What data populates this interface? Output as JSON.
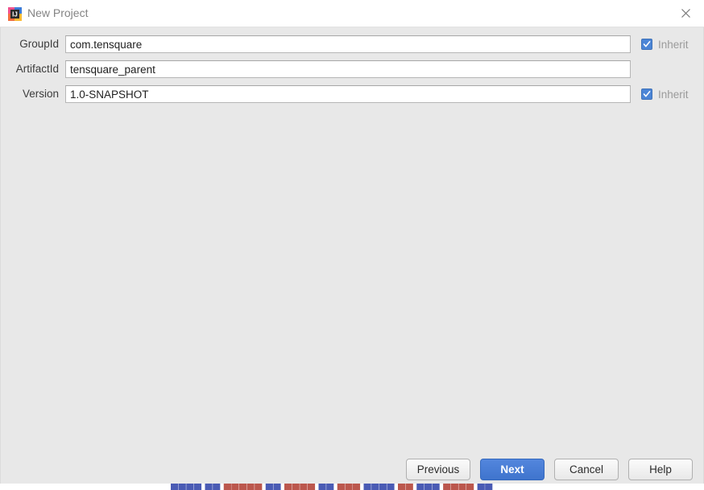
{
  "window": {
    "title": "New Project",
    "app_icon": "intellij-idea-icon",
    "close_icon": "close-icon"
  },
  "form": {
    "rows": [
      {
        "label": "GroupId",
        "value": "com.tensquare",
        "placeholder": "",
        "has_inherit": true,
        "inherit_label": "Inherit",
        "inherit_checked": true
      },
      {
        "label": "ArtifactId",
        "value": "tensquare_parent",
        "placeholder": "",
        "has_inherit": false,
        "inherit_label": "",
        "inherit_checked": false
      },
      {
        "label": "Version",
        "value": "1.0-SNAPSHOT",
        "placeholder": "",
        "has_inherit": true,
        "inherit_label": "Inherit",
        "inherit_checked": true
      }
    ]
  },
  "footer": {
    "previous_label": "Previous",
    "next_label": "Next",
    "cancel_label": "Cancel",
    "help_label": "Help"
  },
  "colors": {
    "accent_blue": "#4b85d6",
    "default_button_blue": "#3f74cd",
    "dialog_background": "#e8e8e8",
    "titlebar_background": "#ffffff",
    "disabled_text": "#9b9b9b"
  }
}
